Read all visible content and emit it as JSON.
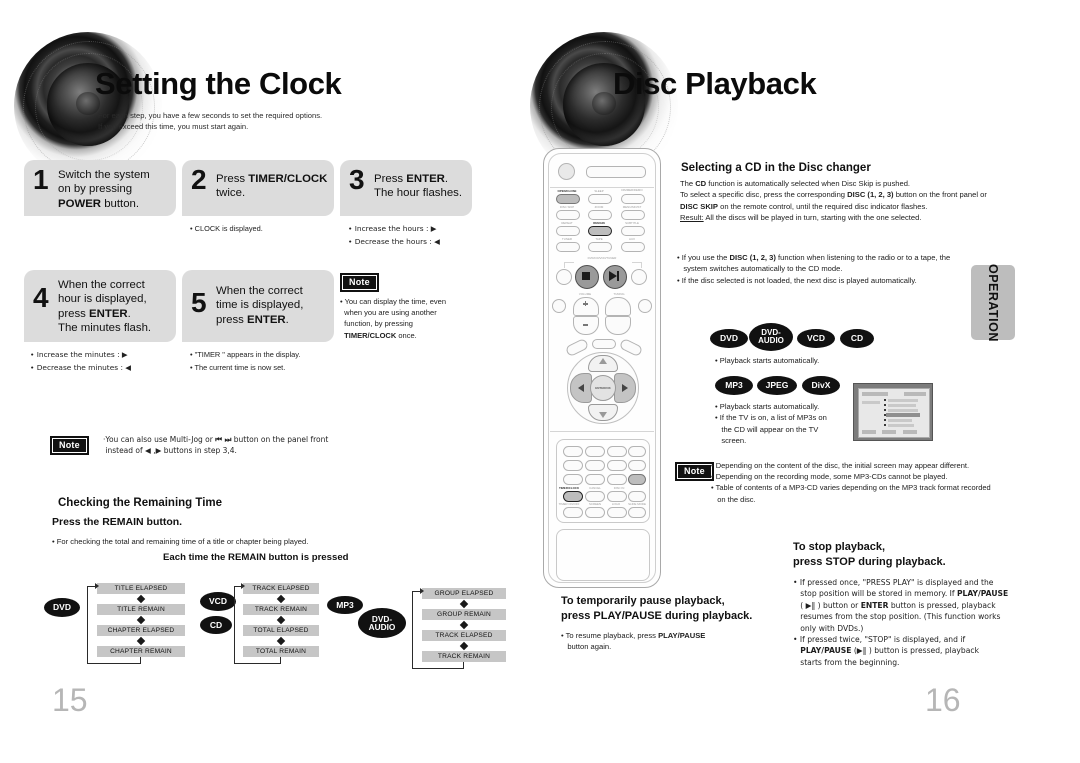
{
  "left_page": {
    "number": "15",
    "chapter_title": "Setting the Clock",
    "chapter_subtitle": "For each step, you have a few seconds to set the required options.\nIf you exceed this time, you must start again.",
    "steps": [
      {
        "num": "1",
        "text_html": "Switch the system<br>on by pressing<br><b>POWER</b> button.",
        "bullets": []
      },
      {
        "num": "2",
        "text_html": "Press <b>TIMER/CLOCK</b><br>twice.",
        "bullets": [
          "• CLOCK  is displayed."
        ]
      },
      {
        "num": "3",
        "text_html": "Press <b>ENTER</b>.<br>The hour flashes.",
        "bullets": [
          "• Increase the hours :  ▶",
          "• Decrease the hours :  ◀"
        ]
      },
      {
        "num": "4",
        "text_html": "When the correct<br>hour is displayed,<br>press <b>ENTER</b>.<br>The minutes flash.",
        "bullets": [
          "• Increase the minutes :  ▶",
          "• Decrease the minutes :  ◀"
        ]
      },
      {
        "num": "5",
        "text_html": "When the correct<br>time is displayed,<br>press <b>ENTER</b>.",
        "bullets": [
          "• \"TIMER \" appears in the display.",
          "• The current time is now set."
        ]
      }
    ],
    "step_note": {
      "chip": "Note",
      "body_html": "• You can display the time, even<br>&nbsp;&nbsp;when you are using another<br>&nbsp;&nbsp;function, by pressing<br>&nbsp;&nbsp;<b>TIMER/CLOCK</b> once."
    },
    "multijog_note": {
      "chip": "Note",
      "body_html": "·You can also  use Multi-Jog or <b>⏮ ⏭</b> button on  the panel front<br>&nbsp;instead of <b>◀</b> ,<b>▶</b>  buttons in step 3,4."
    },
    "remaining": {
      "heading": "Checking the Remaining Time",
      "subheading": "Press the REMAIN button.",
      "bullet": "• For checking the total and remaining time of a title or chapter being played.",
      "diagram_title": "Each time the REMAIN button is pressed"
    },
    "flow": {
      "groups": [
        {
          "labels": [
            "DVD"
          ],
          "label_shapes": [
            "oval"
          ],
          "items": [
            "TITLE ELAPSED",
            "TITLE REMAIN",
            "CHAPTER ELAPSED",
            "CHAPTER REMAIN"
          ]
        },
        {
          "labels": [
            "VCD",
            "CD"
          ],
          "label_shapes": [
            "oval",
            "oval"
          ],
          "items": [
            "TRACK ELAPSED",
            "TRACK REMAIN",
            "TOTAL ELAPSED",
            "TOTAL REMAIN"
          ]
        },
        {
          "labels": [
            "MP3",
            "DVD-\nAUDIO"
          ],
          "label_shapes": [
            "oval",
            "oval"
          ],
          "items": [
            "GROUP ELAPSED",
            "GROUP REMAIN",
            "TRACK ELAPSED",
            "TRACK REMAIN"
          ]
        }
      ]
    }
  },
  "right_page": {
    "number": "16",
    "chapter_title": "Disc Playback",
    "side_tab": "OPERATION",
    "disc_changer": {
      "heading": "Selecting a CD in the Disc changer",
      "para_html": "The <b>CD</b> function is automatically selected when Disc Skip is pushed.<br>To select a specific disc, press the corresponding <b>DISC (1, 2, 3)</b> button on the front panel or<br><b>DISC SKIP</b> on the remote control, until the required disc indicator flashes.<br><u>Result:</u> All the discs will be played in turn, starting with the one selected.",
      "bullets_html": "• If you use the <b>DISC (1, 2, 3)</b> function when listening to the radio or to a tape, the<br>&nbsp;&nbsp;&nbsp;system switches automatically to the CD mode.<br>• If the disc selected is not loaded, the next disc is played automatically."
    },
    "media_row_1": {
      "badges": [
        "DVD",
        "DVD-\nAUDIO",
        "VCD",
        "CD"
      ],
      "bullet": "• Playback starts automatically."
    },
    "media_row_2": {
      "badges": [
        "MP3",
        "JPEG",
        "DivX"
      ],
      "bullets_html": "• Playback starts automatically.<br>• If the TV is on, a list of MP3s on<br>&nbsp;&nbsp;&nbsp;the CD will appear on the TV<br>&nbsp;&nbsp;&nbsp;screen."
    },
    "disc_note": {
      "chip": "Note",
      "body_html": "• Depending on the content of the disc, the initial screen may appear different.<br>• Depending on the recording mode, some MP3-CDs cannot be played.<br>• Table of contents of a MP3-CD varies depending on the MP3 track format recorded<br>&nbsp;&nbsp;&nbsp;on the disc."
    },
    "pause_section": {
      "heading_html": "To temporarily pause playback,<br>press <b>PLAY/PAUSE</b> during playback.",
      "bullet_html": "• To resume playback, press <b>PLAY/PAUSE</b><br>&nbsp;&nbsp;&nbsp;button again."
    },
    "stop_section": {
      "heading_html": "To stop playback,<br>press <b>STOP</b> during playback.",
      "bullets_html": "• If pressed once, \"PRESS PLAY\" is displayed and the<br>&nbsp;&nbsp;&nbsp;stop position will be stored in memory. If <b>PLAY/PAUSE</b><br>&nbsp;&nbsp;&nbsp;( ▶‖ ) button or <b>ENTER</b> button is pressed, playback<br>&nbsp;&nbsp;&nbsp;resumes from the stop position. (This function works<br>&nbsp;&nbsp;&nbsp;only with DVDs.)<br>• If pressed twice, \"STOP\" is displayed, and if<br>&nbsp;&nbsp;&nbsp;<b>PLAY/PAUSE</b> (▶‖ ) button is pressed, playback<br>&nbsp;&nbsp;&nbsp;starts from the beginning."
    },
    "remote": {
      "name": "remote-control-illustration",
      "power_label": "POWER",
      "key_labels": [
        "OPEN/CLOSE",
        "SLEEP",
        "DIMMER/DEMO",
        "DISC SKIP",
        "ZOOM",
        "MENU/MO/ST",
        "REPEAT",
        "REMAIN",
        "SUBTITLE",
        "TUNER",
        "TAPE",
        "AUX",
        "DVD/CD/VCD/TUNER",
        "VOLUME",
        "TUNING",
        "ENTER/OK",
        "TIMER/CLOCK",
        "CANCEL",
        "DISC IN",
        "TIMER ON/OFF",
        "SCREEN",
        "LOGO",
        "SLIDE MODE"
      ]
    }
  },
  "colors": {
    "step_box_bg": "#dcdcdc",
    "flow_box_bg": "#c6c6c6",
    "badge_bg": "#111111",
    "note_chip_bg": "#111111",
    "side_tab_bg": "#bdbdbd",
    "page_num": "#b6b6b6"
  }
}
